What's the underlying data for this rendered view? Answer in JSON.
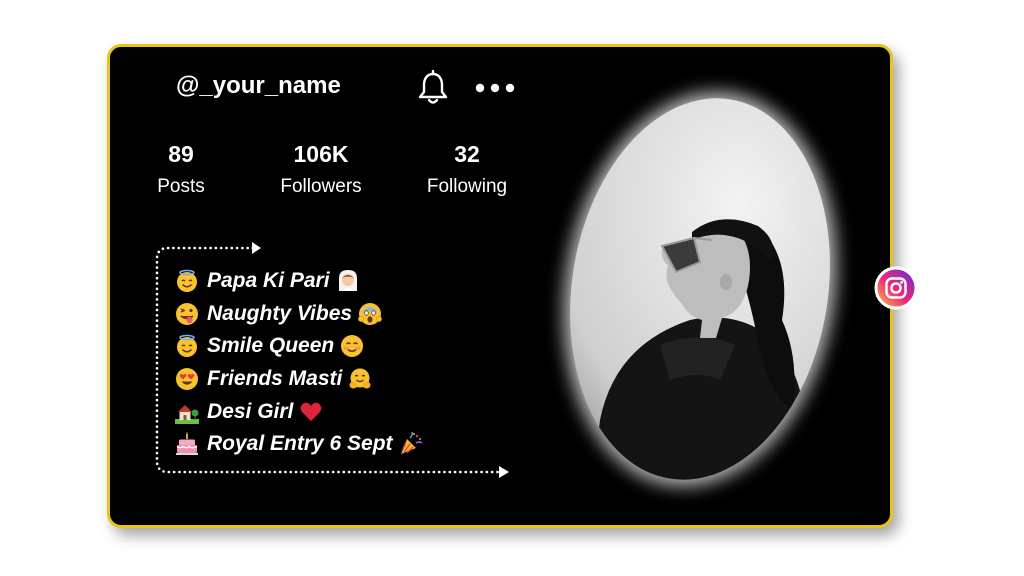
{
  "profile": {
    "username": "@_your_name",
    "stats": [
      {
        "value": "89",
        "label": "Posts"
      },
      {
        "value": "106K",
        "label": "Followers"
      },
      {
        "value": "32",
        "label": "Following"
      }
    ],
    "bio": [
      {
        "emoji_before": "angel-face",
        "text": "Papa Ki Pari",
        "emoji_after": "bride-person"
      },
      {
        "emoji_before": "winking-tongue-face",
        "text": "Naughty Vibes",
        "emoji_after": "screaming-face"
      },
      {
        "emoji_before": "angel-face",
        "text": "Smile Queen",
        "emoji_after": "smiling-blush-face"
      },
      {
        "emoji_before": "heart-eyes-face",
        "text": "Friends Masti",
        "emoji_after": "hugging-face"
      },
      {
        "emoji_before": "house-garden",
        "text": "Desi Girl",
        "emoji_after": "red-heart"
      },
      {
        "emoji_before": "birthday-cake",
        "text": "Royal Entry 6 Sept",
        "emoji_after": "party-popper"
      }
    ]
  },
  "icons": {
    "notification": "bell-icon",
    "menu": "more-options-icon",
    "social": "instagram-icon"
  },
  "colors": {
    "card_background": "#000000",
    "card_border": "#e8c31a",
    "text": "#ffffff"
  }
}
